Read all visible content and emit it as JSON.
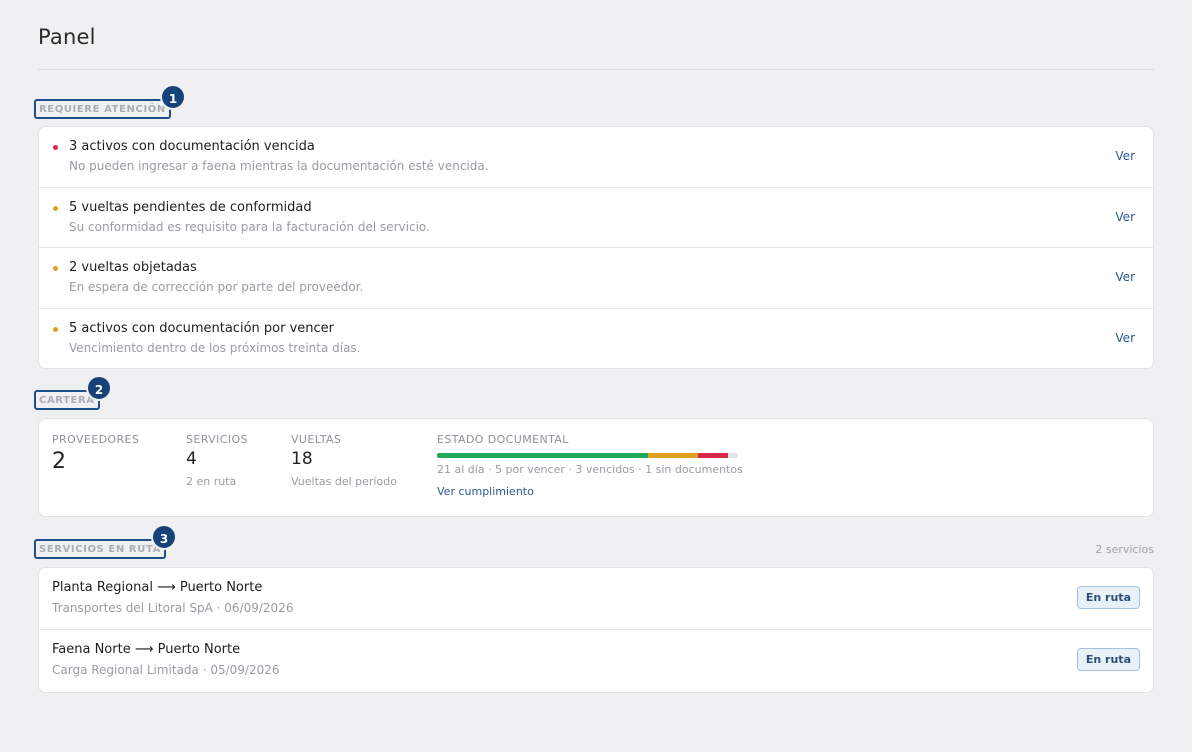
{
  "page": {
    "title": "Panel"
  },
  "attention": {
    "label": "REQUIERE ATENCIÓN",
    "marker": "1",
    "items": [
      {
        "title": "3 activos con documentación vencida",
        "description": "No pueden ingresar a faena mientras la documentación esté vencida.",
        "severity_color": "#d6294a",
        "action": "Ver"
      },
      {
        "title": "5 vueltas pendientes de conformidad",
        "description": "Su conformidad es requisito para la facturación del servicio.",
        "severity_color": "#e0a01c",
        "action": "Ver"
      },
      {
        "title": "2 vueltas objetadas",
        "description": "En espera de corrección por parte del proveedor.",
        "severity_color": "#e0a01c",
        "action": "Ver"
      },
      {
        "title": "5 activos con documentación por vencer",
        "description": "Vencimiento dentro de los próximos treinta días.",
        "severity_color": "#e0a01c",
        "action": "Ver"
      }
    ]
  },
  "portfolio": {
    "label": "CARTERA",
    "marker": "2",
    "providers": {
      "label": "PROVEEDORES",
      "value": "2"
    },
    "services": {
      "label": "SERVICIOS",
      "value": "4",
      "sub": "2 en ruta"
    },
    "trips": {
      "label": "VUELTAS",
      "value": "18",
      "sub": "Vueltas del período"
    },
    "doc_status": {
      "label": "ESTADO DOCUMENTAL",
      "counts": {
        "al_dia": 21,
        "por_vencer": 5,
        "vencidos": 3,
        "sin_documentos": 1
      },
      "colors": {
        "al_dia": "#1faa5a",
        "por_vencer": "#e0a01c",
        "vencidos": "#d6294a",
        "sin_documentos": "#e6e6e8"
      },
      "summary": "21 al día · 5 por vencer · 3 vencidos · 1 sin documentos",
      "link": "Ver cumplimiento"
    }
  },
  "routes": {
    "label": "SERVICIOS EN RUTA",
    "marker": "3",
    "count": "2 servicios",
    "items": [
      {
        "title": "Planta Regional ⟶ Puerto Norte",
        "subtitle": "Transportes del Litoral SpA · 06/09/2026",
        "status": "En ruta"
      },
      {
        "title": "Faena Norte ⟶ Puerto Norte",
        "subtitle": "Carga Regional Limitada · 05/09/2026",
        "status": "En ruta"
      }
    ]
  }
}
